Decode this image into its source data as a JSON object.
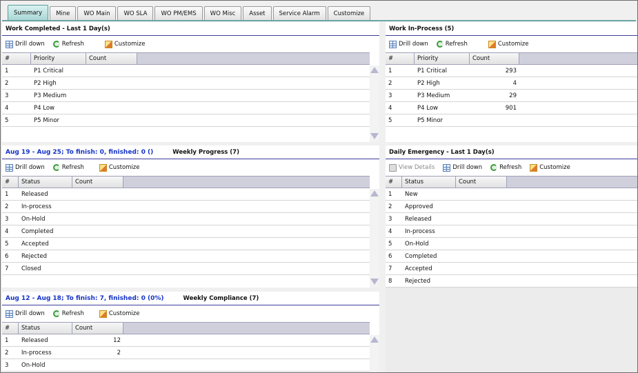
{
  "tabs": [
    "Summary",
    "Mine",
    "WO Main",
    "WO SLA",
    "WO PM/EMS",
    "WO Misc",
    "Asset",
    "Service Alarm",
    "Customize"
  ],
  "active_tab": "Summary",
  "toolbar": {
    "drill_down": "Drill down",
    "refresh": "Refresh",
    "customize": "Customize",
    "view_details": "View Details"
  },
  "panels": {
    "work_completed": {
      "title": "Work Completed - Last 1 Day(s)",
      "headers": [
        "#",
        "Priority",
        "Count"
      ],
      "rows": [
        {
          "n": "1",
          "label": "P1 Critical",
          "count": ""
        },
        {
          "n": "2",
          "label": "P2 High",
          "count": ""
        },
        {
          "n": "3",
          "label": "P3 Medium",
          "count": ""
        },
        {
          "n": "4",
          "label": "P4 Low",
          "count": ""
        },
        {
          "n": "5",
          "label": "P5 Minor",
          "count": ""
        }
      ]
    },
    "work_in_process": {
      "title": "Work In-Process (5)",
      "headers": [
        "#",
        "Priority",
        "Count"
      ],
      "rows": [
        {
          "n": "1",
          "label": "P1 Critical",
          "count": "293"
        },
        {
          "n": "2",
          "label": "P2 High",
          "count": "4"
        },
        {
          "n": "3",
          "label": "P3 Medium",
          "count": "29"
        },
        {
          "n": "4",
          "label": "P4 Low",
          "count": "901"
        },
        {
          "n": "5",
          "label": "P5 Minor",
          "count": ""
        }
      ]
    },
    "weekly_progress": {
      "range_text": "Aug 19 - Aug 25; To finish: 0, finished: 0 ()",
      "title": "Weekly Progress (7)",
      "headers": [
        "#",
        "Status",
        "Count"
      ],
      "rows": [
        {
          "n": "1",
          "label": "Released",
          "count": ""
        },
        {
          "n": "2",
          "label": "In-process",
          "count": ""
        },
        {
          "n": "3",
          "label": "On-Hold",
          "count": ""
        },
        {
          "n": "4",
          "label": "Completed",
          "count": ""
        },
        {
          "n": "5",
          "label": "Accepted",
          "count": ""
        },
        {
          "n": "6",
          "label": "Rejected",
          "count": ""
        },
        {
          "n": "7",
          "label": "Closed",
          "count": ""
        }
      ]
    },
    "daily_emergency": {
      "title": "Daily Emergency - Last 1 Day(s)",
      "headers": [
        "#",
        "Status",
        "Count"
      ],
      "rows": [
        {
          "n": "1",
          "label": "New",
          "count": ""
        },
        {
          "n": "2",
          "label": "Approved",
          "count": ""
        },
        {
          "n": "3",
          "label": "Released",
          "count": ""
        },
        {
          "n": "4",
          "label": "In-process",
          "count": ""
        },
        {
          "n": "5",
          "label": "On-Hold",
          "count": ""
        },
        {
          "n": "6",
          "label": "Completed",
          "count": ""
        },
        {
          "n": "7",
          "label": "Accepted",
          "count": ""
        },
        {
          "n": "8",
          "label": "Rejected",
          "count": ""
        }
      ]
    },
    "weekly_compliance": {
      "range_text": "Aug 12 - Aug 18; To finish: 7, finished: 0 (0%)",
      "title": "Weekly Compliance (7)",
      "headers": [
        "#",
        "Status",
        "Count"
      ],
      "rows": [
        {
          "n": "1",
          "label": "Released",
          "count": "12"
        },
        {
          "n": "2",
          "label": "In-process",
          "count": "2"
        },
        {
          "n": "3",
          "label": "On-Hold",
          "count": ""
        }
      ]
    }
  },
  "colors": {
    "tab_active": "#a9d7d5",
    "link_blue": "#1433c8",
    "header_bar": "#cfd0dc"
  },
  "icons": [
    "drill-down-icon",
    "refresh-icon",
    "customize-icon",
    "view-details-icon",
    "scroll-up-icon",
    "scroll-down-icon"
  ]
}
